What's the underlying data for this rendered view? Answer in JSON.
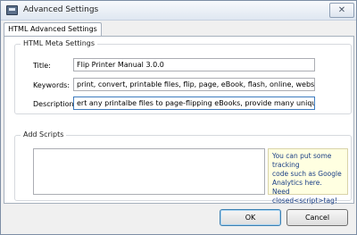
{
  "window": {
    "title": "Advanced Settings",
    "close_glyph": "✕",
    "icons": {
      "app": "app-window-icon",
      "close": "close-icon"
    }
  },
  "tabs": [
    {
      "label": "HTML Advanced Settings",
      "selected": true
    }
  ],
  "meta_group": {
    "legend": "HTML Meta Settings",
    "title_label": "Title:",
    "title_value": "Flip Printer  Manual 3.0.0",
    "keywords_label": "Keywords:",
    "keywords_value": "print, convert, printable files, flip, page, eBook, flash, online, website, uploac",
    "description_label": "Description:",
    "description_value": "ert any printalbe files to page-flipping eBooks, provide many unique features."
  },
  "scripts_group": {
    "legend": "Add Scripts",
    "script_value": "",
    "hint_lines": [
      "You can put some tracking",
      "code such as Google",
      "Analytics here.",
      "Need closed<script>tag!"
    ]
  },
  "buttons": {
    "ok_label": "OK",
    "cancel_label": "Cancel"
  }
}
